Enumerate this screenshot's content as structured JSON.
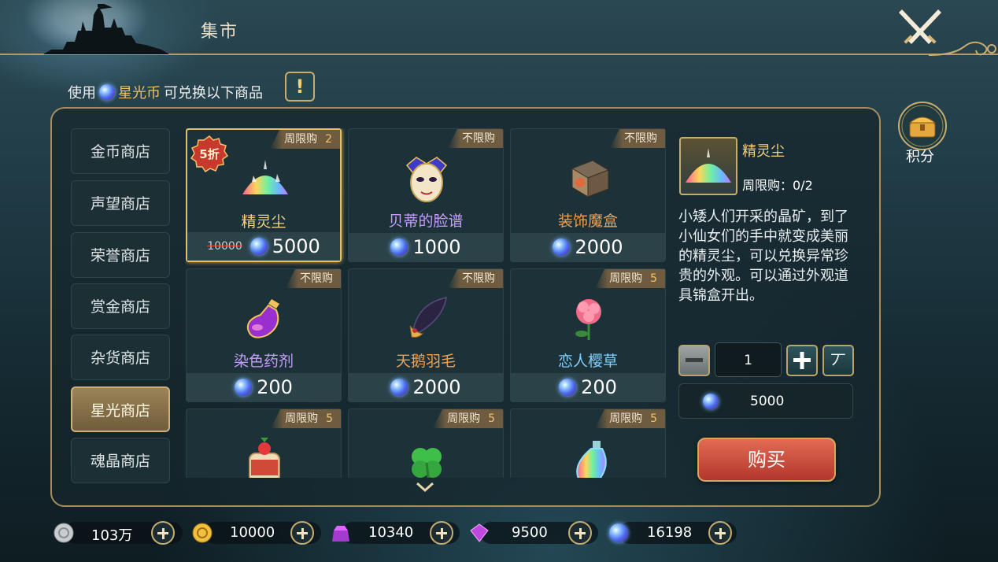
{
  "header": {
    "title": "集市"
  },
  "info": {
    "prefix": "使用",
    "currency": "星光币",
    "suffix": "可兑换以下商品",
    "help": "!"
  },
  "tabs": [
    {
      "label": "金币商店"
    },
    {
      "label": "声望商店"
    },
    {
      "label": "荣誉商店"
    },
    {
      "label": "赏金商店"
    },
    {
      "label": "杂货商店"
    },
    {
      "label": "星光商店",
      "active": true
    },
    {
      "label": "魂晶商店"
    }
  ],
  "items": [
    {
      "name": "精灵尘",
      "name_color": "#f0d282",
      "limit": "周限购",
      "limit_count": "2",
      "old_price": "10000",
      "price": "5000",
      "discount": "5折",
      "icon": "crystal-dust-icon",
      "selected": true
    },
    {
      "name": "贝蒂的脸谱",
      "name_color": "#c79cff",
      "limit": "不限购",
      "limit_count": "",
      "price": "1000",
      "icon": "jester-mask-icon"
    },
    {
      "name": "装饰魔盒",
      "name_color": "#f0a050",
      "limit": "不限购",
      "limit_count": "",
      "price": "2000",
      "icon": "magic-box-icon"
    },
    {
      "name": "染色药剂",
      "name_color": "#c79cff",
      "limit": "不限购",
      "limit_count": "",
      "price": "200",
      "icon": "dye-potion-icon"
    },
    {
      "name": "天鹅羽毛",
      "name_color": "#f0a050",
      "limit": "不限购",
      "limit_count": "",
      "price": "2000",
      "icon": "swan-feather-icon"
    },
    {
      "name": "恋人樱草",
      "name_color": "#7fd0ff",
      "limit": "周限购",
      "limit_count": "5",
      "price": "200",
      "icon": "primrose-icon"
    },
    {
      "name": "",
      "limit": "周限购",
      "limit_count": "5",
      "price": "",
      "icon": "jam-jar-icon"
    },
    {
      "name": "",
      "limit": "周限购",
      "limit_count": "5",
      "price": "",
      "icon": "clover-icon"
    },
    {
      "name": "",
      "limit": "周限购",
      "limit_count": "5",
      "price": "",
      "icon": "rainbow-bottle-icon"
    }
  ],
  "detail": {
    "name": "精灵尘",
    "limit": "周限购：0/2",
    "description": "小矮人们开采的晶矿，到了小仙女们的手中就变成美丽的精灵尘，可以兑换异常珍贵的外观。可以通过外观道具锦盒开出。",
    "quantity": "1",
    "max_label": "丆",
    "total": "5000",
    "buy_label": "购买"
  },
  "points": {
    "label": "积分"
  },
  "currencies": [
    {
      "name": "silver",
      "value": "103万"
    },
    {
      "name": "gold",
      "value": "10000"
    },
    {
      "name": "purple-gem-bag",
      "value": "10340"
    },
    {
      "name": "purple-gem",
      "value": "9500"
    },
    {
      "name": "star-coin",
      "value": "16198"
    }
  ]
}
